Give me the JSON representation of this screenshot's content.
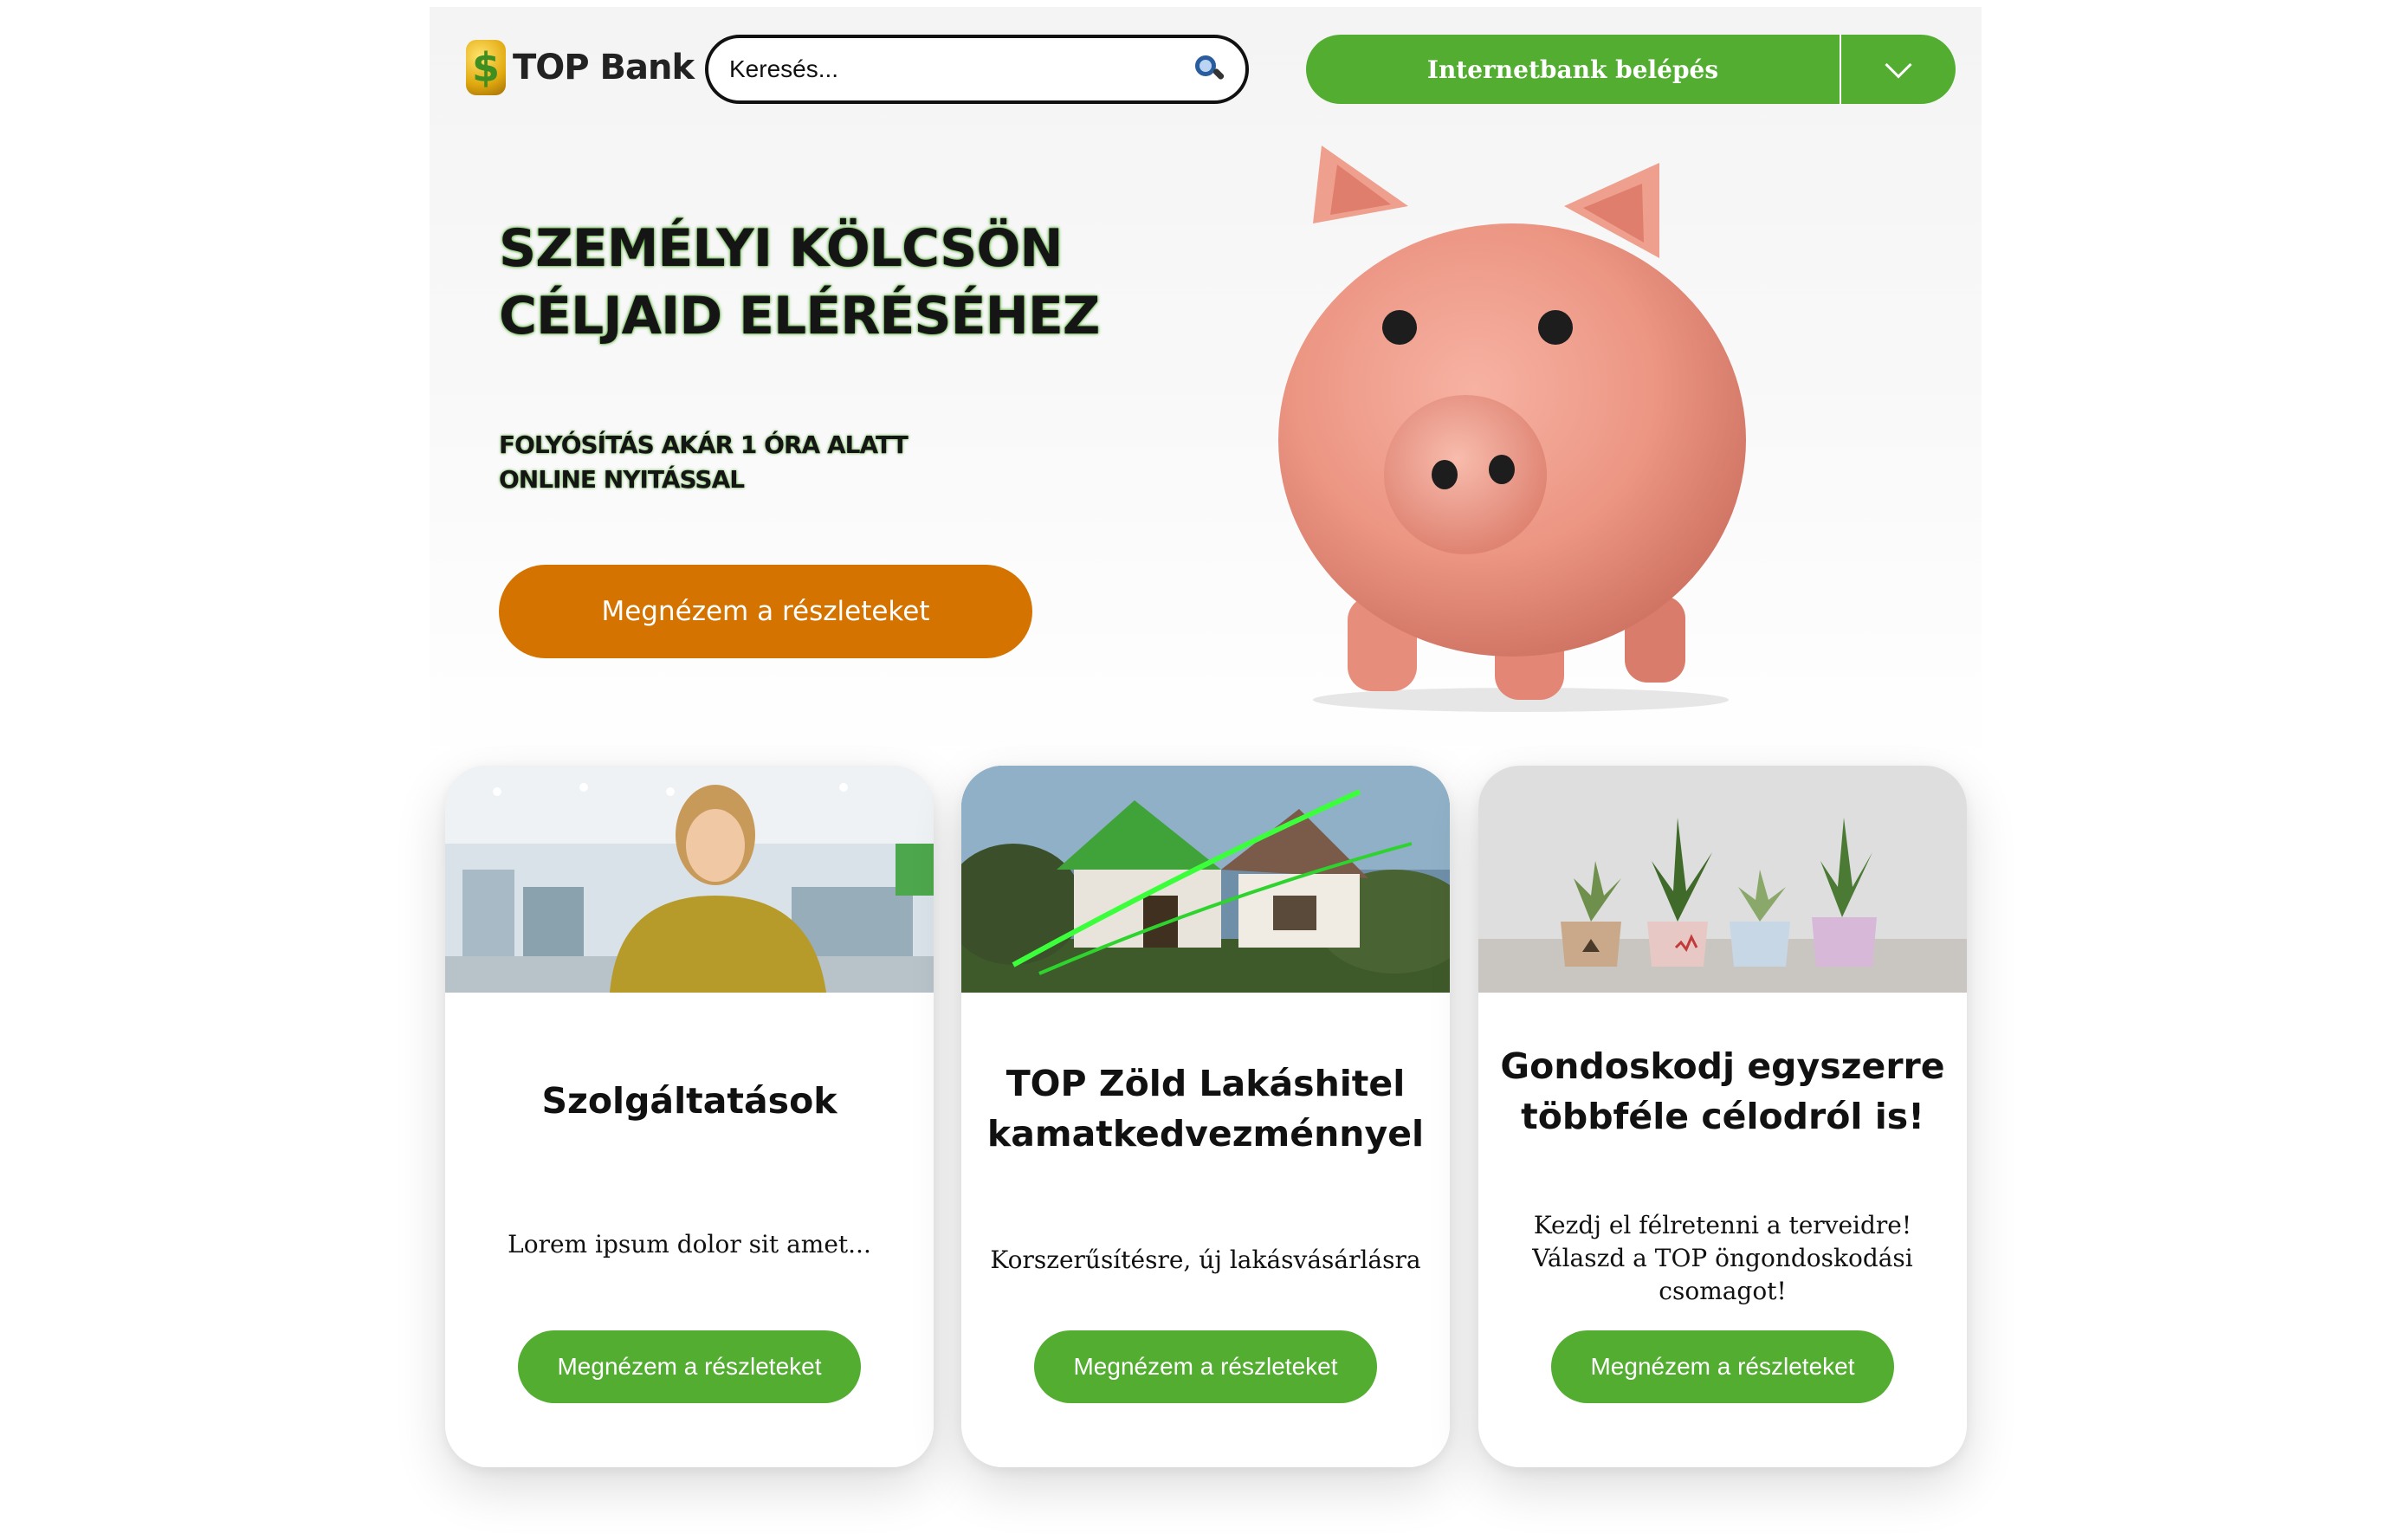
{
  "header": {
    "logo_symbol": "$",
    "logo_text": "TOP Bank",
    "search_placeholder": "Keresés...",
    "login_label": "Internetbank belépés"
  },
  "hero": {
    "title_lines": [
      "SZEMÉLYI KÖLCSÖN",
      "CÉLJAID ELÉRÉSÉHEZ"
    ],
    "subtitle_lines": [
      "FOLYÓSÍTÁS AKÁR 1 ÓRA ALATT",
      "ONLINE NYITÁSSAL"
    ],
    "cta_label": "Megnézem a részleteket"
  },
  "cards": [
    {
      "title": "Szolgáltatások",
      "text": "Lorem ipsum dolor sit amet...",
      "button_label": "Megnézem a részleteket"
    },
    {
      "title": "TOP Zöld Lakáshitel kamatkedvezménnyel",
      "text": "Korszerűsítésre, új lakásvásárlásra",
      "button_label": "Megnézem a részleteket"
    },
    {
      "title": "Gondoskodj egyszerre többféle célodról is!",
      "text": "Kezdj el félretenni a terveidre! Válaszd a TOP öngondoskodási csomagot!",
      "button_label": "Megnézem a részleteket"
    }
  ],
  "colors": {
    "brand_green": "#52ad31",
    "cta_orange": "#d57300"
  }
}
